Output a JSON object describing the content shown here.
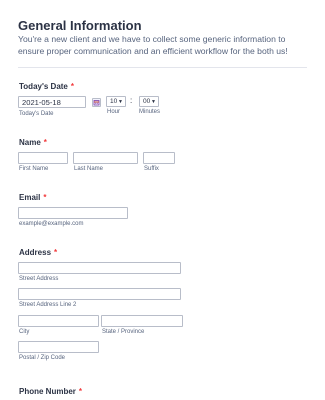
{
  "header": {
    "title": "General Information",
    "description": "You're a new client and we have to collect some generic information to ensure proper communication and an efficient workflow for the both us!"
  },
  "required_marker": "*",
  "date_field": {
    "label": "Today's Date",
    "value": "2021-05-18",
    "sublabel": "Today's Date",
    "hour": {
      "value": "10",
      "sublabel": "Hour"
    },
    "colon": ":",
    "minutes": {
      "value": "00",
      "sublabel": "Minutes"
    },
    "calendar_icon": "calendar-icon",
    "dropdown_icon": "chevron-down-icon"
  },
  "name_field": {
    "label": "Name",
    "first_sublabel": "First Name",
    "last_sublabel": "Last Name",
    "suffix_sublabel": "Suffix"
  },
  "email_field": {
    "label": "Email",
    "sublabel": "example@example.com"
  },
  "address_field": {
    "label": "Address",
    "street_sublabel": "Street Address",
    "street2_sublabel": "Street Address Line 2",
    "city_sublabel": "City",
    "state_sublabel": "State / Province",
    "postal_sublabel": "Postal / Zip Code"
  },
  "phone_field": {
    "label": "Phone Number"
  },
  "colors": {
    "text": "#2c3345",
    "muted": "#57647e",
    "required": "#f23a3c",
    "border": "#b8bdc9",
    "divider": "#e3e5ec"
  }
}
